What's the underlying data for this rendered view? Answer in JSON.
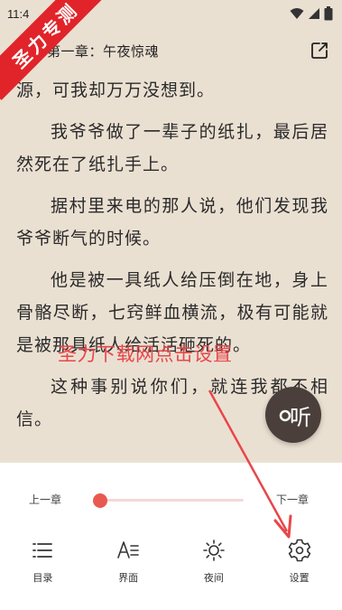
{
  "status_bar": {
    "time": "11:4"
  },
  "watermark": {
    "text": "圣力专测"
  },
  "header": {
    "chapter_title": "第一章：午夜惊魂"
  },
  "content": {
    "paragraphs": [
      "源，可我却万万没想到。",
      "我爷爷做了一辈子的纸扎，最后居然死在了纸扎手上。",
      "据村里来电的那人说，他们发现我爷爷断气的时候。",
      "他是被一具纸人给压倒在地，身上骨骼尽断，七窍鲜血横流，极有可能就是被那具纸人给活活砸死的。",
      "这种事别说你们，就连我都不相信。"
    ]
  },
  "annotation": {
    "text": "圣力下载网点击设置"
  },
  "listen_button": {
    "label": "听"
  },
  "progress": {
    "prev_label": "上一章",
    "next_label": "下一章",
    "value": 0.0
  },
  "bottom_nav": [
    {
      "label": "目录",
      "icon": "list-icon"
    },
    {
      "label": "界面",
      "icon": "text-format-icon"
    },
    {
      "label": "夜间",
      "icon": "sun-icon"
    },
    {
      "label": "设置",
      "icon": "gear-icon"
    }
  ],
  "colors": {
    "page_background": "#eae0d2",
    "accent": "#e85a50",
    "watermark": "#e0242a",
    "annotation": "#e8464a"
  }
}
